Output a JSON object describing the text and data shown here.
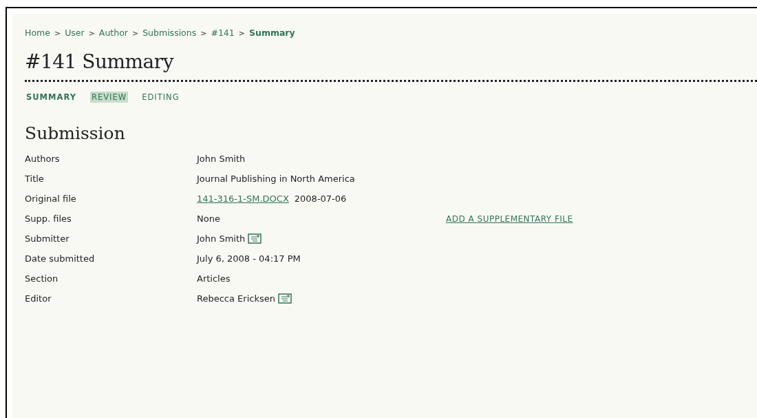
{
  "breadcrumb": {
    "separator": ">",
    "items": [
      {
        "label": "Home",
        "current": false
      },
      {
        "label": "User",
        "current": false
      },
      {
        "label": "Author",
        "current": false
      },
      {
        "label": "Submissions",
        "current": false
      },
      {
        "label": "#141",
        "current": false
      },
      {
        "label": "Summary",
        "current": true
      }
    ]
  },
  "page_title": "#141 Summary",
  "tabs": [
    {
      "label": "SUMMARY",
      "selected": true,
      "highlighted": false
    },
    {
      "label": "REVIEW",
      "selected": false,
      "highlighted": true
    },
    {
      "label": "EDITING",
      "selected": false,
      "highlighted": false
    }
  ],
  "section_title": "Submission",
  "rows": [
    {
      "kind": "text",
      "label": "Authors",
      "value": "John Smith"
    },
    {
      "kind": "text",
      "label": "Title",
      "value": "Journal Publishing in North America"
    },
    {
      "kind": "file",
      "label": "Original file",
      "link": "141-316-1-SM.DOCX",
      "value": "2008-07-06"
    },
    {
      "kind": "action",
      "label": "Supp. files",
      "value": "None",
      "link": "ADD A SUPPLEMENTARY FILE"
    },
    {
      "kind": "contact",
      "label": "Submitter",
      "value": "John Smith"
    },
    {
      "kind": "text",
      "label": "Date submitted",
      "value": "July 6, 2008 - 04:17 PM"
    },
    {
      "kind": "text",
      "label": "Section",
      "value": "Articles"
    },
    {
      "kind": "contact",
      "label": "Editor",
      "value": "Rebecca Ericksen"
    }
  ]
}
